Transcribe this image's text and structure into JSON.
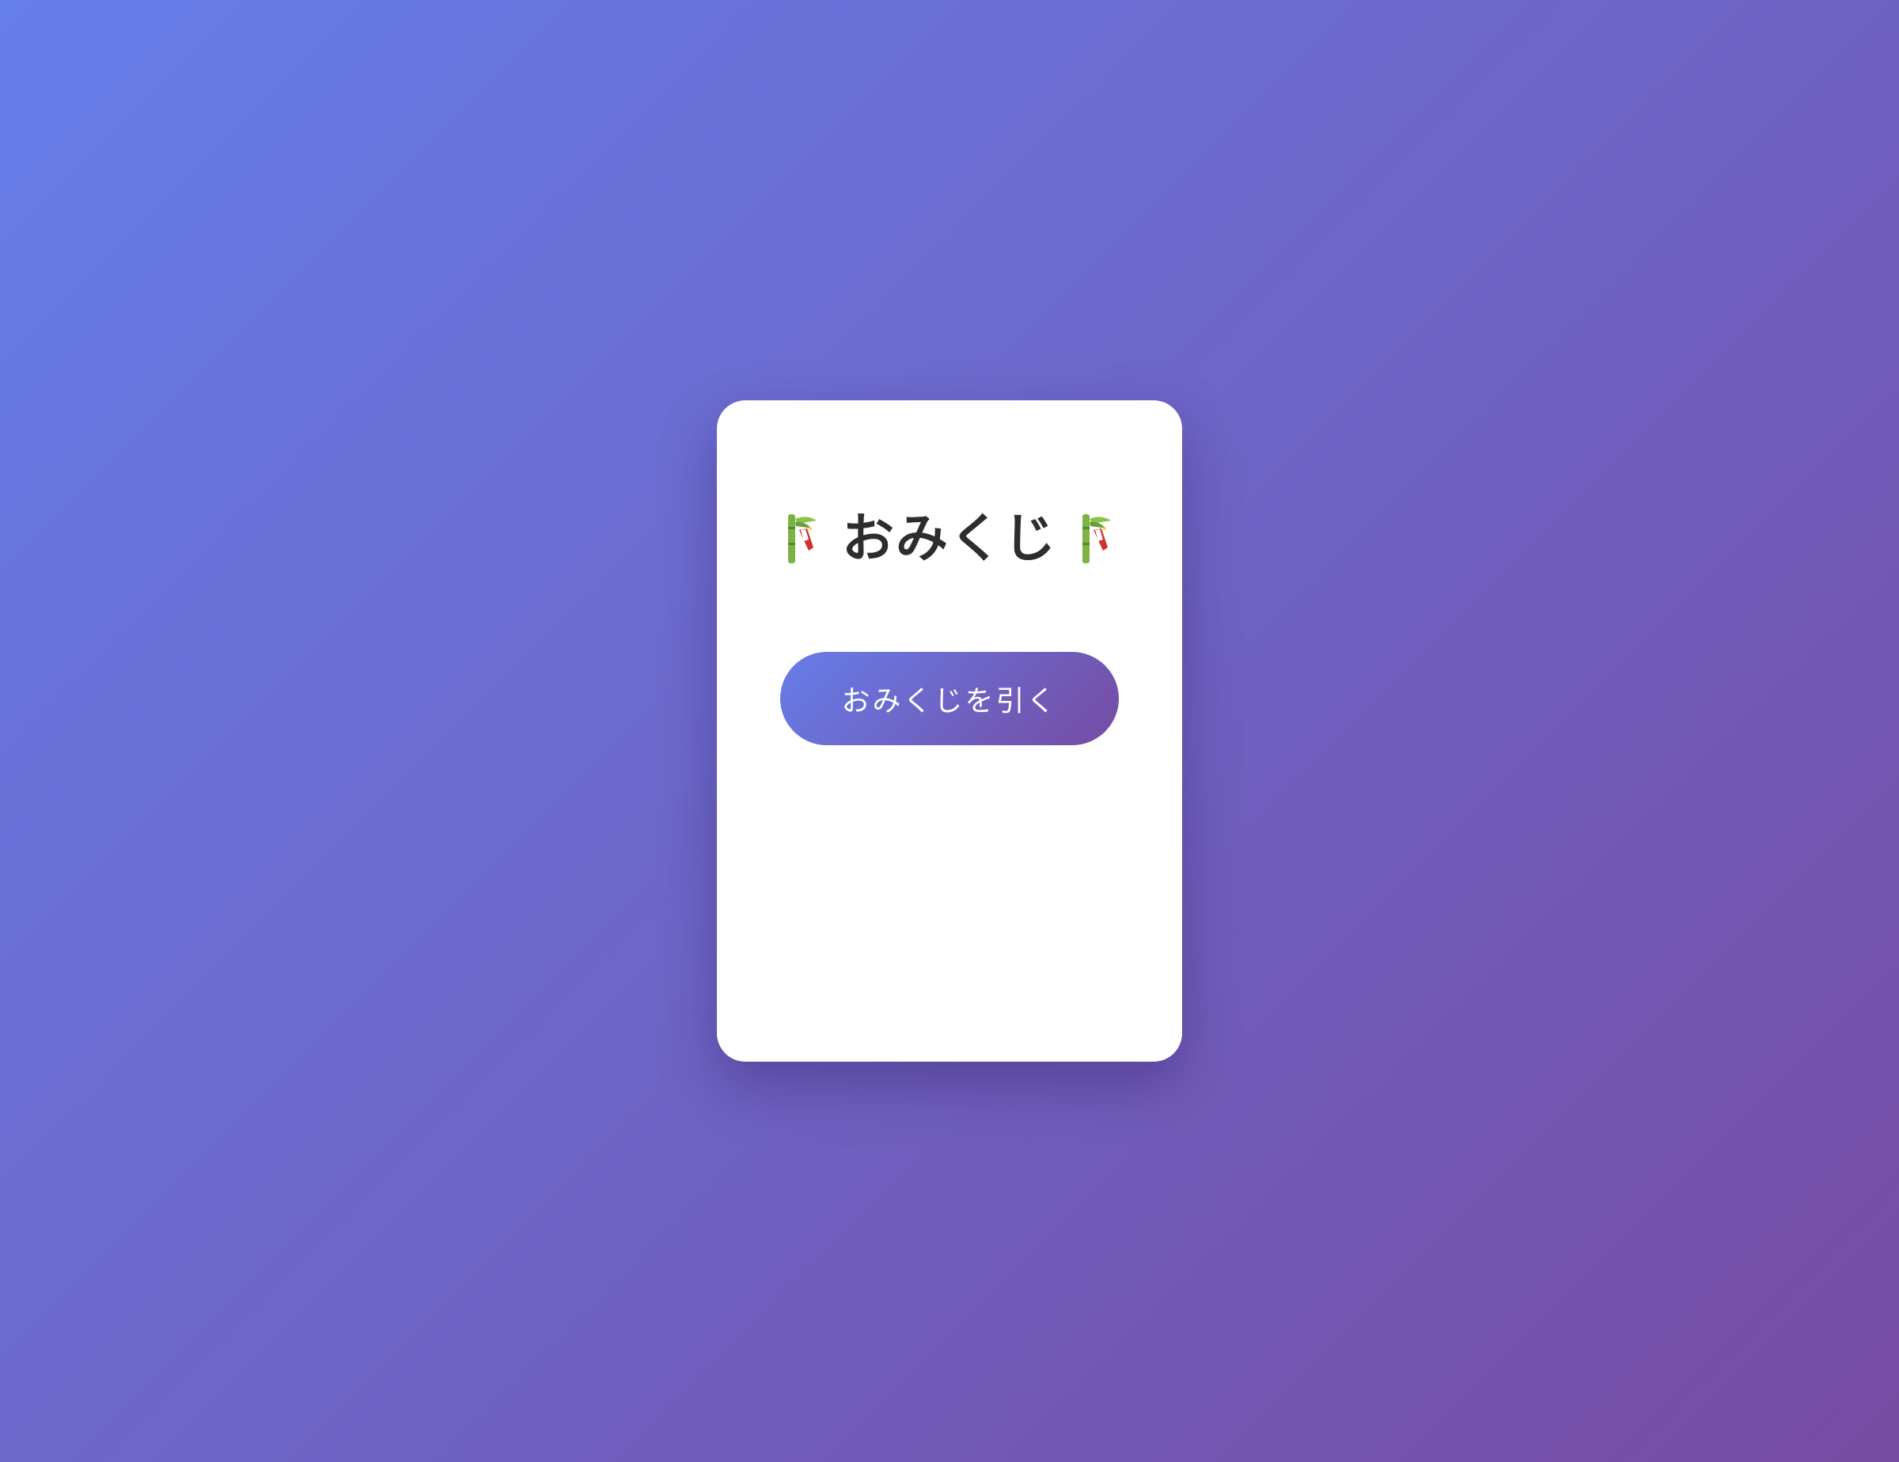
{
  "card": {
    "title": "おみくじ",
    "title_icon_left": "tanabata-tree-icon",
    "title_icon_right": "tanabata-tree-icon",
    "draw_button_label": "おみくじを引く"
  },
  "colors": {
    "background_gradient_start": "#667eea",
    "background_gradient_end": "#764ba2",
    "card_background": "#ffffff",
    "title_text": "#2d2d2d",
    "button_text": "#ffffff"
  }
}
